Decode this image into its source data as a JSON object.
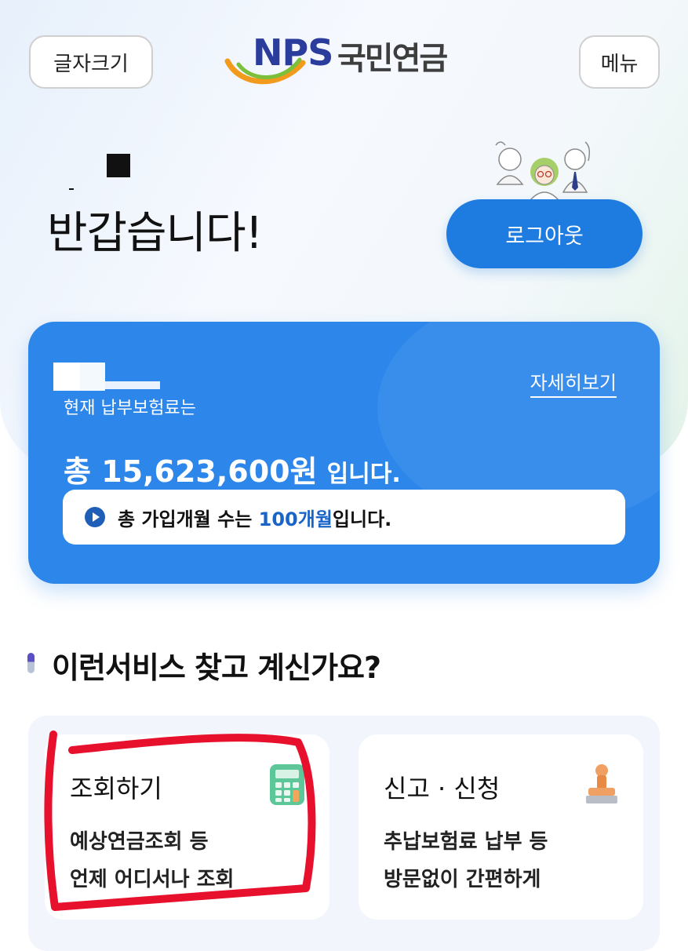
{
  "header": {
    "font_size_label": "글자크기",
    "logo_brand": "NPS",
    "logo_name": "국민연금",
    "menu_label": "메뉴"
  },
  "hero": {
    "greeting": "반갑습니다!",
    "logout_label": "로그아웃"
  },
  "summary_card": {
    "label": "현재 납부보험료는",
    "detail_link": "자세히보기",
    "total_prefix": "총",
    "total_amount": "15,623,600원",
    "total_suffix": "입니다.",
    "months_prefix": "총 가입개월 수는",
    "months_value": "100개월",
    "months_suffix": "입니다."
  },
  "section": {
    "title": "이런서비스 찾고 계신가요?"
  },
  "services": [
    {
      "title": "조회하기",
      "line1": "예상연금조회 등",
      "line2": "언제 어디서나 조회",
      "icon": "calculator-icon"
    },
    {
      "title": "신고 · 신청",
      "line1": "추납보험료 납부 등",
      "line2": "방문없이 간편하게",
      "icon": "stamp-icon"
    }
  ],
  "colors": {
    "primary_blue": "#2d86ea",
    "logout_blue": "#1e7be0",
    "months_highlight": "#1a64c8",
    "annotation_red": "#e8112d"
  }
}
